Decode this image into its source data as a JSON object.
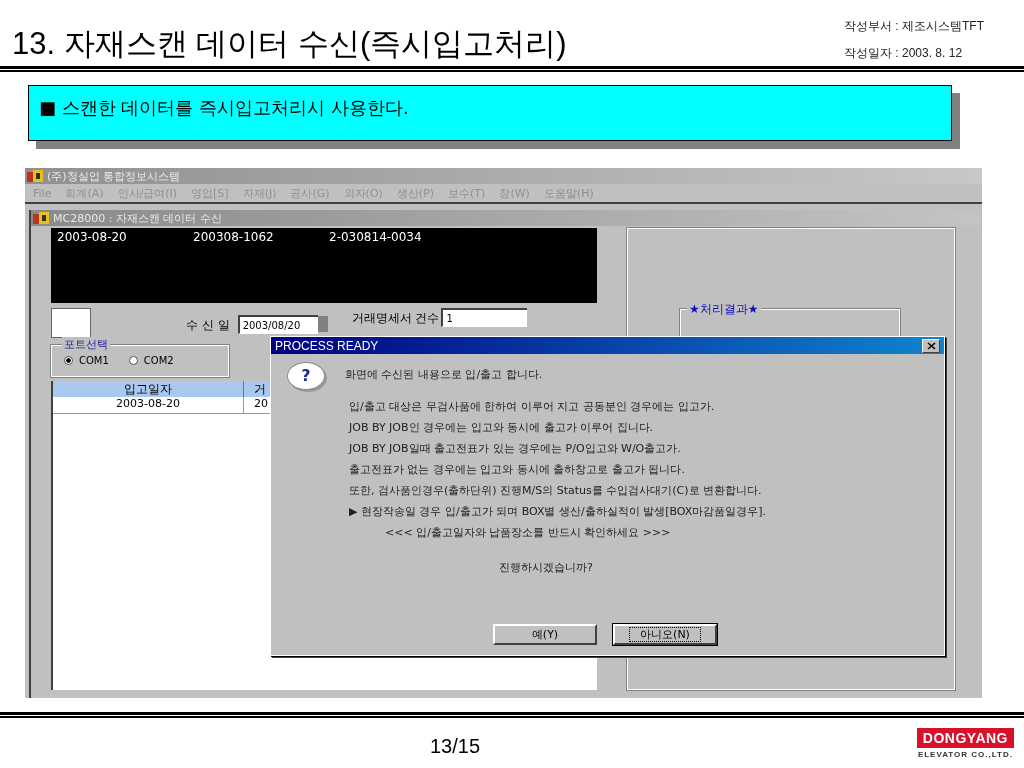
{
  "slide": {
    "title": "13. 자재스캔 데이터 수신(즉시입고처리)",
    "department": "작성부서 : 제조시스템TFT",
    "date": "작성일자 : 2003. 8. 12",
    "callout": "■ 스캔한 데이터를 즉시입고처리시 사용한다.",
    "page": "13/15",
    "logo": {
      "name": "DONGYANG",
      "subtitle": "ELEVATOR CO.,LTD."
    }
  },
  "app": {
    "title": "(주)청실업 통합정보시스템",
    "menu": [
      "File",
      "회계(A)",
      "인사/급여(I)",
      "영업[S]",
      "자재(J)",
      "공사(G)",
      "외자(O)",
      "생산(P)",
      "보수(T)",
      "창(W)",
      "도움말(H)"
    ],
    "child_window": {
      "title": "MC28000 : 자재스캔 데이터 수신",
      "scan_rows": [
        [
          "2003-08-20",
          "200308-1062",
          "2-030814-0034"
        ]
      ],
      "receive_label": "수 신 일",
      "receive_date": "2003/08/20",
      "statement_label": "거래명세서 건수",
      "statement_count": "1",
      "port_group": {
        "title": "포트선택",
        "options": [
          {
            "label": "COM1",
            "selected": true
          },
          {
            "label": "COM2",
            "selected": false
          }
        ]
      },
      "table": {
        "columns": [
          "입고일자",
          "거"
        ],
        "rows": [
          [
            "2003-08-20",
            "20"
          ]
        ]
      },
      "result_group": "★처리결과★"
    }
  },
  "dialog": {
    "title": "PROCESS READY",
    "icon_glyph": "?",
    "lines": [
      {
        "kind": "lead",
        "text": "화면에 수신된 내용으로 입/출고 합니다."
      },
      {
        "kind": "body",
        "text": "입/출고 대상은 무검사품에 한하여 이루어 지고 공동분인 경우에는 입고가."
      },
      {
        "kind": "body",
        "text": "JOB BY JOB인 경우에는 입고와 동시에 출고가 이루어 집니다."
      },
      {
        "kind": "body",
        "text": "JOB BY JOB일때 출고전표가 있는 경우에는 P/O입고와 W/O출고가."
      },
      {
        "kind": "body",
        "text": "출고전표가 없는 경우에는 입고와 동시에 출하창고로 출고가 됩니다."
      },
      {
        "kind": "body",
        "text": "또한, 검사품인경우(출하단위) 진행M/S의 Status를 수입검사대기(C)로 변환합니다."
      },
      {
        "kind": "body",
        "text": "▶ 현장작송일 경우 입/출고가 되며 BOX별 생산/출하실적이 발생[BOX마감품일경우]."
      },
      {
        "kind": "note",
        "text": "<<< 입/출고일자와 납품장소를 반드시 확인하세요 >>>"
      },
      {
        "kind": "question",
        "text": "진행하시겠습니까?"
      }
    ],
    "buttons": [
      {
        "label": "예(Y)",
        "focused": false
      },
      {
        "label": "아니오(N)",
        "focused": true
      }
    ]
  }
}
